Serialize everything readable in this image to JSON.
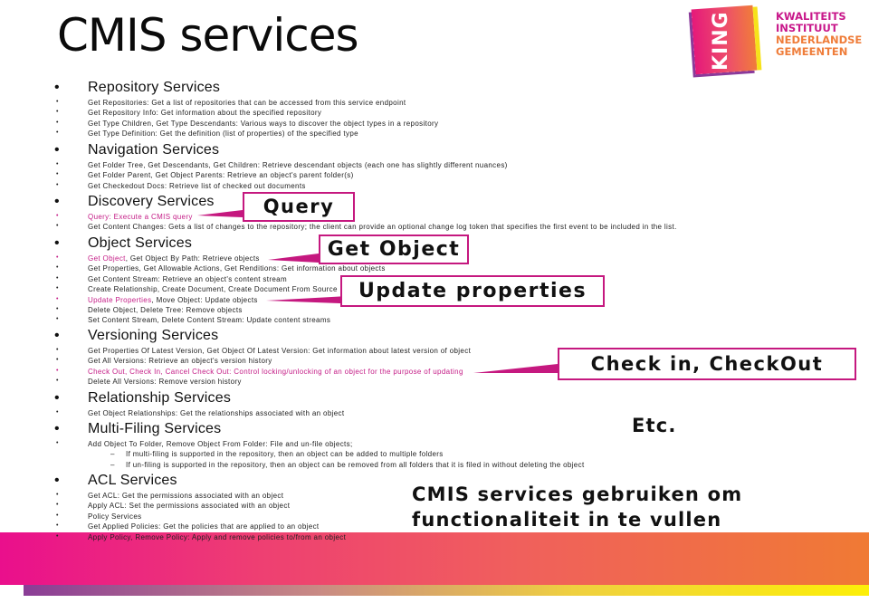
{
  "title": "CMIS services",
  "logo": {
    "mark": "KING",
    "lines": [
      "KWALITEITS",
      "INSTITUUT",
      "NEDERLANDSE",
      "GEMEENTEN"
    ]
  },
  "colors": {
    "accent_pink": "#c41c86",
    "callout_border": "#c5187f",
    "band_start": "#ea0f8c",
    "band_end": "#f07a34",
    "strip_start": "#8a3d96",
    "strip_end": "#fcef08"
  },
  "sections": [
    {
      "heading": "Repository Services",
      "items": [
        {
          "text": "Get Repositories: Get a list of repositories that can be accessed from this service endpoint"
        },
        {
          "text": "Get Repository Info: Get information about the specified repository"
        },
        {
          "text": "Get Type Children, Get Type Descendants: Various ways to discover the object types in a repository"
        },
        {
          "text": "Get Type Definition: Get the definition (list of properties) of the specified type"
        }
      ]
    },
    {
      "heading": "Navigation Services",
      "items": [
        {
          "text": "Get Folder Tree, Get Descendants, Get Children: Retrieve descendant objects (each one has slightly different nuances)"
        },
        {
          "text": "Get Folder Parent, Get Object Parents: Retrieve an object's parent folder(s)"
        },
        {
          "text": "Get Checkedout Docs: Retrieve list of checked out documents"
        }
      ]
    },
    {
      "heading": "Discovery Services",
      "items": [
        {
          "text": "Query: Execute a CMIS query",
          "highlight": true
        },
        {
          "text": "Get Content Changes: Gets a list of changes to the repository; the client can provide an optional change log token that specifies the first event to be included in the list."
        }
      ]
    },
    {
      "heading": "Object Services",
      "items": [
        {
          "hl_part": "Get Object",
          "text": ", Get Object By Path: Retrieve objects"
        },
        {
          "text": "Get Properties, Get Allowable Actions, Get Renditions: Get information about objects"
        },
        {
          "text": "Get Content Stream: Retrieve an object's content stream"
        },
        {
          "text": "Create Relationship, Create Document, Create Document From Source"
        },
        {
          "hl_part": "Update Properties",
          "text": ", Move Object: Update objects"
        },
        {
          "text": "Delete Object, Delete Tree: Remove objects"
        },
        {
          "text": "Set Content Stream, Delete Content Stream: Update content streams"
        }
      ]
    },
    {
      "heading": "Versioning Services",
      "items": [
        {
          "text": "Get Properties Of Latest Version, Get Object Of Latest Version: Get information about latest version of object"
        },
        {
          "text": "Get All Versions: Retrieve an object's version history"
        },
        {
          "text": "Check Out, Check In, Cancel Check Out: Control locking/unlocking of an object for the purpose of updating",
          "highlight": true
        },
        {
          "text": "Delete All Versions: Remove version history"
        }
      ]
    },
    {
      "heading": "Relationship Services",
      "items": [
        {
          "text": "Get Object Relationships: Get the relationships associated with an object"
        }
      ]
    },
    {
      "heading": "Multi-Filing Services",
      "items": [
        {
          "text": "Add Object To Folder, Remove Object From Folder: File and un-file objects;"
        },
        {
          "text": "If multi-filing is supported in the repository, then an object can be added to multiple folders",
          "sub": true
        },
        {
          "text": "If un-filing is supported in the repository, then an object can be removed from all folders that it is filed in without deleting the object",
          "sub": true
        }
      ]
    },
    {
      "heading": "ACL Services",
      "items": [
        {
          "text": "Get ACL: Get the permissions associated with an object"
        },
        {
          "text": "Apply ACL: Set the permissions associated with an object"
        },
        {
          "text": "Policy Services"
        },
        {
          "text": "Get Applied Policies: Get the policies that are applied to an object"
        },
        {
          "text": "Apply Policy, Remove Policy: Apply and remove policies to/from an object"
        }
      ]
    }
  ],
  "callouts": {
    "query": "Query",
    "get_object": "Get Object",
    "update_properties": "Update properties",
    "checkin": "Check in, CheckOut",
    "etc": "Etc.",
    "summary_line1": "CMIS services gebruiken om",
    "summary_line2": "functionaliteit in te vullen"
  }
}
